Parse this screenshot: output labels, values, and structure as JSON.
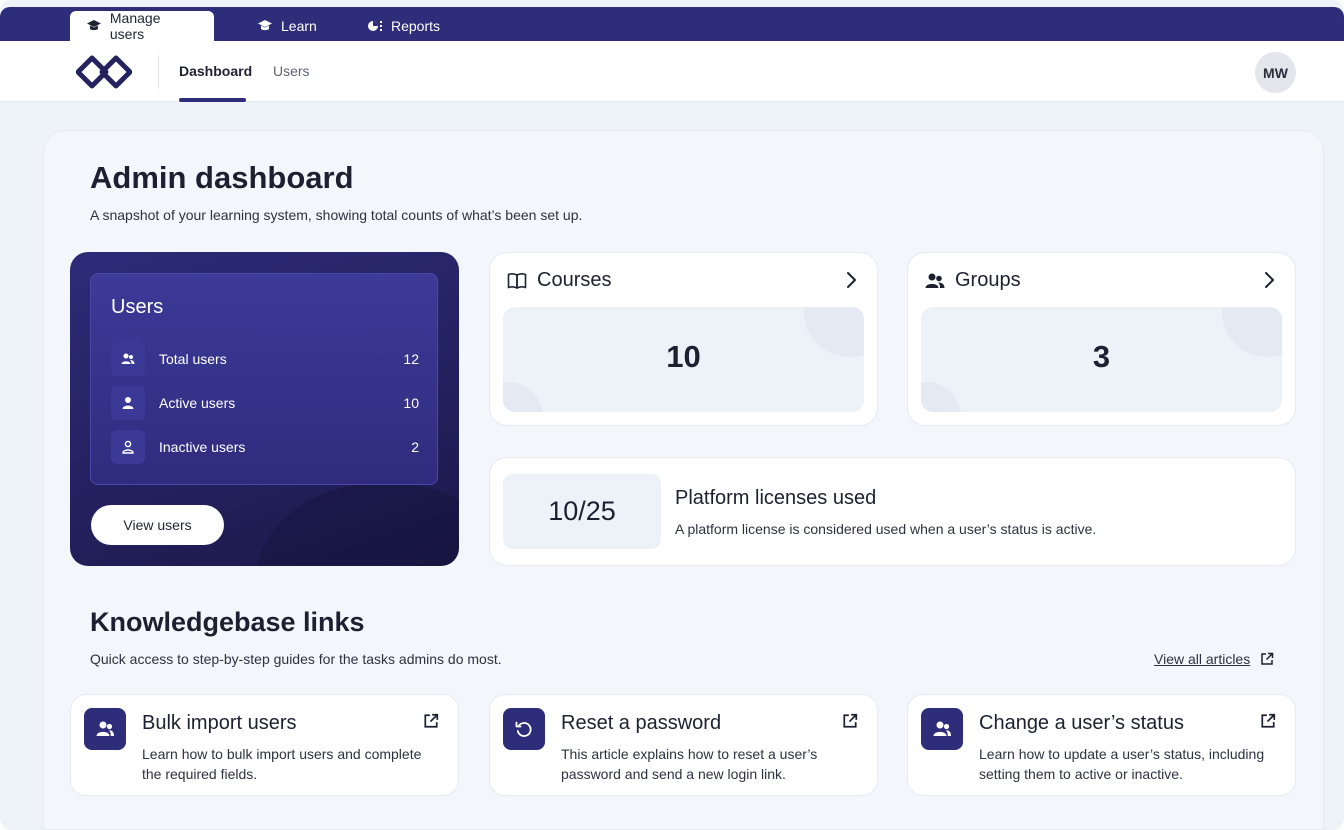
{
  "app_tabs": [
    {
      "label": "Manage users",
      "icon": "graduation-cap-icon"
    },
    {
      "label": "Learn",
      "icon": "graduation-cap-icon"
    },
    {
      "label": "Reports",
      "icon": "pie-chart-icon"
    }
  ],
  "nav": {
    "links": [
      "Dashboard",
      "Users"
    ],
    "active": "Dashboard",
    "avatar_initials": "MW"
  },
  "page": {
    "title": "Admin dashboard",
    "subtitle": "A snapshot of your learning system, showing total counts of what’s been set up."
  },
  "users_card": {
    "title": "Users",
    "rows": [
      {
        "label": "Total users",
        "value": "12",
        "icon": "users-icon"
      },
      {
        "label": "Active users",
        "value": "10",
        "icon": "user-icon"
      },
      {
        "label": "Inactive users",
        "value": "2",
        "icon": "user-outline-icon"
      }
    ],
    "button": "View users"
  },
  "courses_card": {
    "title": "Courses",
    "value": "10",
    "icon": "book-icon"
  },
  "groups_card": {
    "title": "Groups",
    "value": "3",
    "icon": "group-icon"
  },
  "licenses": {
    "value": "10/25",
    "title": "Platform licenses used",
    "description": "A platform license is considered used when a user’s status is active."
  },
  "knowledgebase": {
    "title": "Knowledgebase links",
    "subtitle": "Quick access to step-by-step guides for the tasks admins do most.",
    "view_all": "View all articles",
    "articles": [
      {
        "title": "Bulk import users",
        "description": "Learn how to bulk import users and complete the required fields.",
        "icon": "users-icon"
      },
      {
        "title": "Reset a password",
        "description": "This article explains how to reset a user’s password and send a new login link.",
        "icon": "reset-icon"
      },
      {
        "title": "Change a user’s status",
        "description": "Learn how to update a user’s status, including setting them to active or inactive.",
        "icon": "users-icon"
      }
    ]
  },
  "colors": {
    "brand": "#2e2d7a",
    "background": "#eef2f9",
    "card": "#ffffff"
  }
}
